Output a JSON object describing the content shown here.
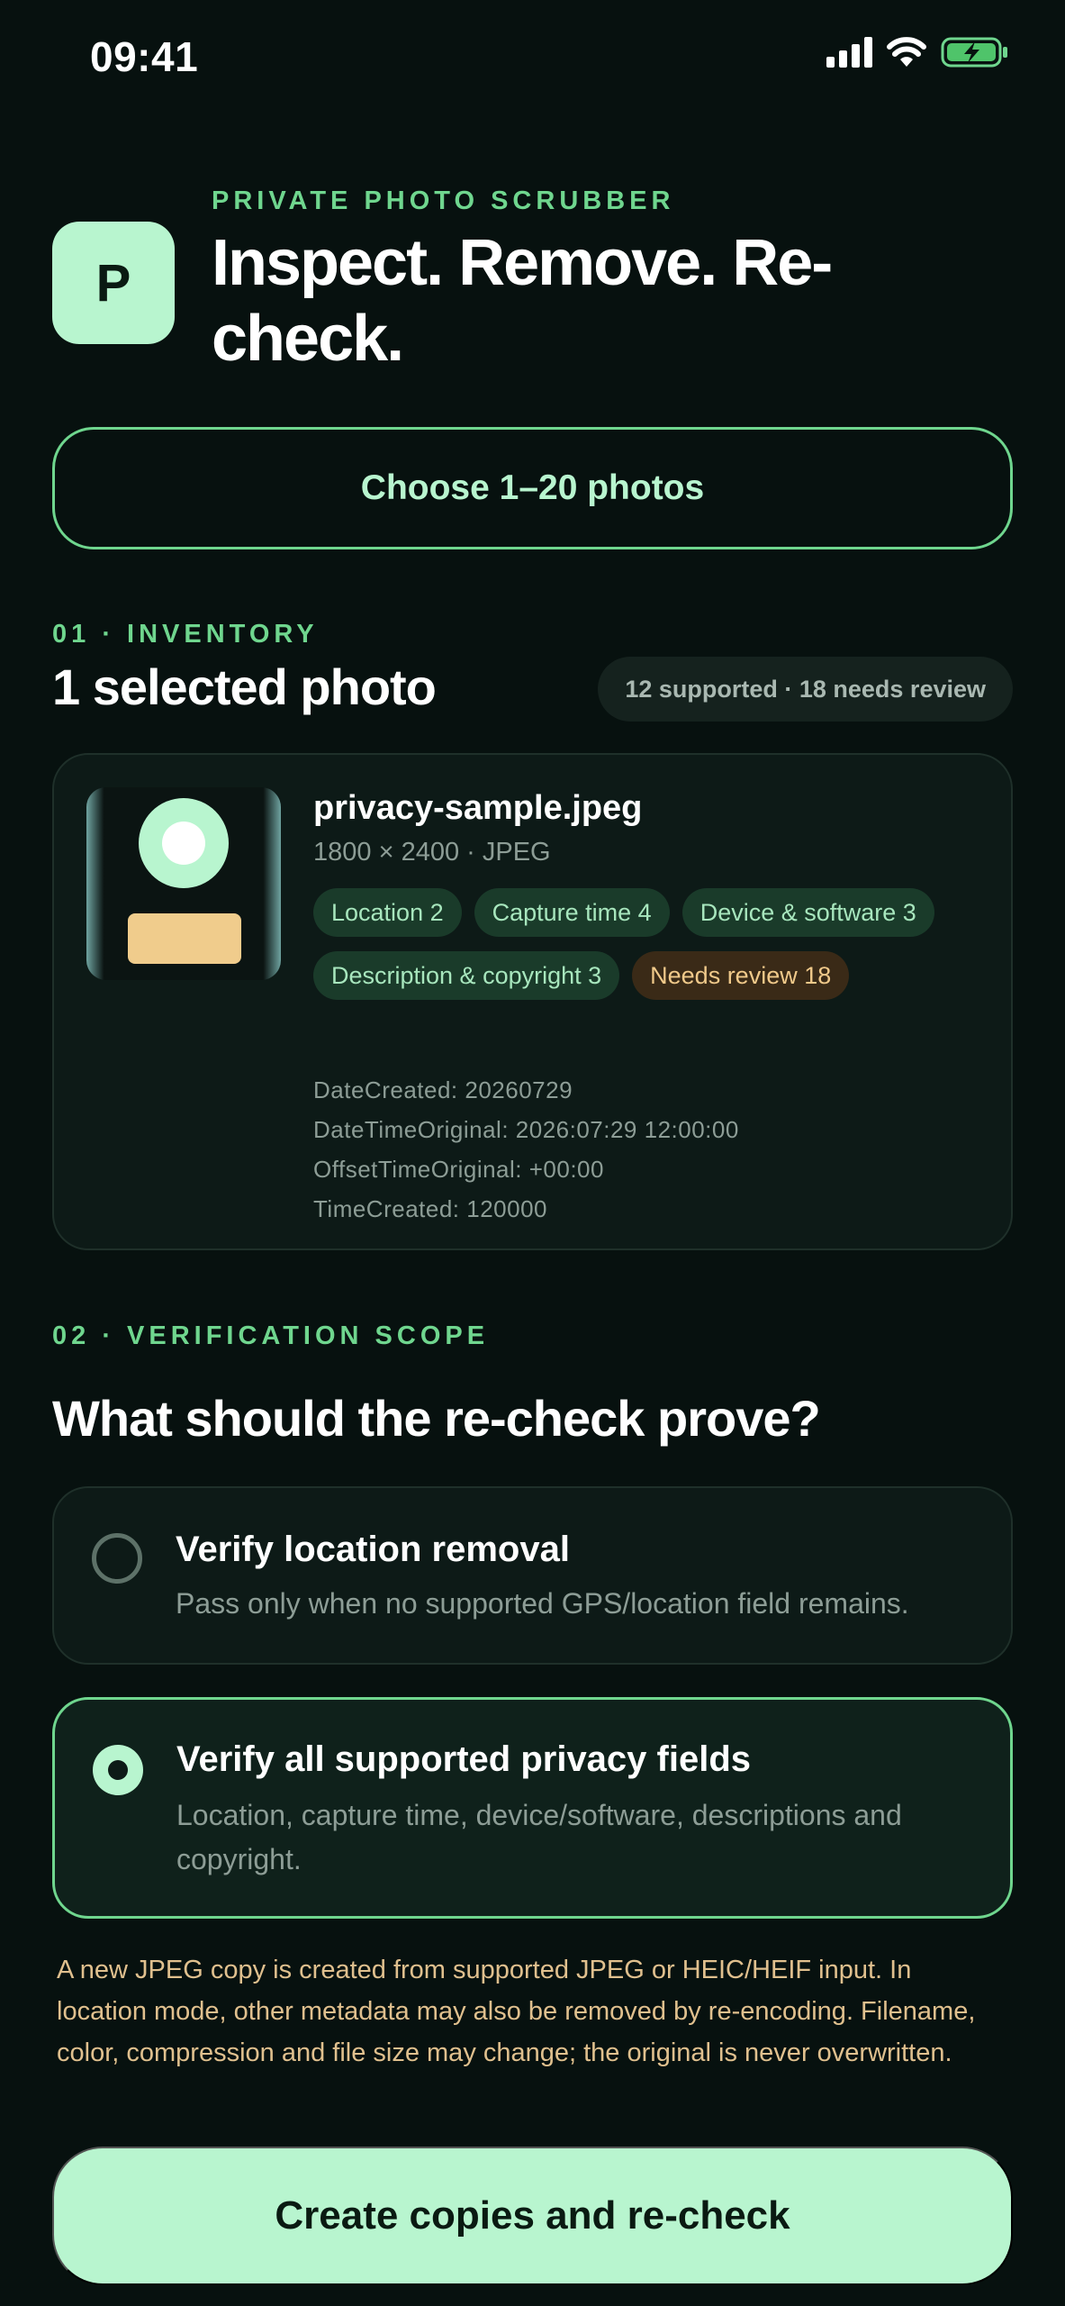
{
  "status_bar": {
    "time": "09:41"
  },
  "header": {
    "app_icon_letter": "P",
    "eyebrow": "PRIVATE PHOTO SCRUBBER",
    "title": "Inspect. Remove. Re-check."
  },
  "choose_button": {
    "label": "Choose 1–20 photos"
  },
  "inventory": {
    "section_label": "01 · INVENTORY",
    "title": "1 selected photo",
    "summary": "12 supported · 18 needs review",
    "photo": {
      "file_name": "privacy-sample.jpeg",
      "meta": "1800 × 2400 · JPEG",
      "tags": [
        {
          "label": "Location 2",
          "kind": "ok"
        },
        {
          "label": "Capture time 4",
          "kind": "ok"
        },
        {
          "label": "Device & software 3",
          "kind": "ok"
        },
        {
          "label": "Description & copyright 3",
          "kind": "ok"
        },
        {
          "label": "Needs review 18",
          "kind": "warn"
        }
      ],
      "fields": [
        "DateCreated: 20260729",
        "DateTimeOriginal: 2026:07:29 12:00:00",
        "OffsetTimeOriginal: +00:00",
        "TimeCreated: 120000"
      ]
    }
  },
  "verification": {
    "section_label": "02 · VERIFICATION SCOPE",
    "title": "What should the re-check prove?",
    "options": [
      {
        "title": "Verify location removal",
        "description": "Pass only when no supported GPS/location field remains.",
        "selected": false
      },
      {
        "title": "Verify all supported privacy fields",
        "description": "Location, capture time, device/software, descriptions and copyright.",
        "selected": true
      }
    ]
  },
  "disclaimer": "A new JPEG copy is created from supported JPEG or HEIC/HEIF input. In location mode, other metadata may also be removed by re-encoding. Filename, color, compression and file size may change; the original is never overwritten.",
  "cta": {
    "label": "Create copies and re-check"
  },
  "colors": {
    "background": "#07110f",
    "accent": "#6fd68e",
    "accent_light": "#b8f5cf",
    "warning": "#e0c08e"
  }
}
